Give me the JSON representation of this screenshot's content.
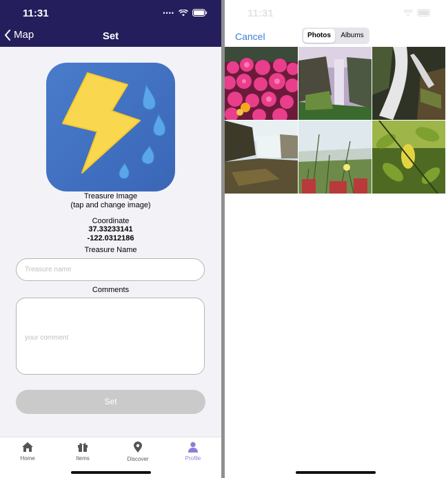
{
  "status": {
    "time": "11:31"
  },
  "header": {
    "back_label": "Map",
    "title": "Set"
  },
  "treasure_image": {
    "label": "Treasure Image",
    "hint": "(tap and change image)"
  },
  "coordinate": {
    "label": "Coordinate",
    "latitude": "37.33233141",
    "longitude": "-122.0312186"
  },
  "treasure_name": {
    "label": "Treasure Name",
    "placeholder": "Treasure name"
  },
  "comments": {
    "label": "Comments",
    "placeholder": "your comment"
  },
  "set_button": {
    "label": "Set"
  },
  "tabbar": {
    "items": [
      {
        "label": "Home",
        "icon": "home-icon"
      },
      {
        "label": "Items",
        "icon": "gift-icon"
      },
      {
        "label": "Discover",
        "icon": "location-pin-icon"
      },
      {
        "label": "Profile",
        "icon": "person-icon",
        "active": true
      }
    ]
  },
  "picker": {
    "cancel_label": "Cancel",
    "segments": [
      "Photos",
      "Albums"
    ],
    "selected_segment": "Photos",
    "photos": [
      "pink-flowers-photo",
      "waterfall-cliff-photo",
      "waterfall-rocks-photo",
      "waterfall-coast-photo",
      "grass-dunes-photo",
      "green-leaves-photo"
    ]
  },
  "colors": {
    "header_bg": "#251e5c",
    "accent": "#3e7fd0",
    "active_tab": "#8b7fd6",
    "button_disabled": "#cacaca"
  }
}
